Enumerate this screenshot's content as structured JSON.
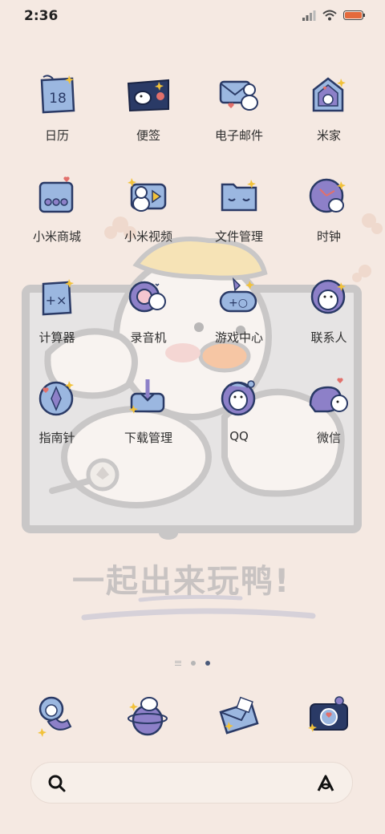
{
  "status_bar": {
    "time": "2:36"
  },
  "wallpaper": {
    "caption": "一起出来玩鸭!"
  },
  "apps": [
    {
      "label": "日历",
      "icon": "calendar-icon",
      "badge": "18"
    },
    {
      "label": "便签",
      "icon": "notes-icon"
    },
    {
      "label": "电子邮件",
      "icon": "email-icon"
    },
    {
      "label": "米家",
      "icon": "mijia-icon"
    },
    {
      "label": "小米商城",
      "icon": "mi-store-icon"
    },
    {
      "label": "小米视频",
      "icon": "mi-video-icon"
    },
    {
      "label": "文件管理",
      "icon": "file-manager-icon"
    },
    {
      "label": "时钟",
      "icon": "clock-icon"
    },
    {
      "label": "计算器",
      "icon": "calculator-icon"
    },
    {
      "label": "录音机",
      "icon": "recorder-icon"
    },
    {
      "label": "游戏中心",
      "icon": "game-center-icon"
    },
    {
      "label": "联系人",
      "icon": "contacts-icon"
    },
    {
      "label": "指南针",
      "icon": "compass-icon"
    },
    {
      "label": "下载管理",
      "icon": "downloads-icon"
    },
    {
      "label": "QQ",
      "icon": "qq-icon"
    },
    {
      "label": "微信",
      "icon": "wechat-icon"
    }
  ],
  "dock": [
    {
      "icon": "phone-icon"
    },
    {
      "icon": "browser-icon"
    },
    {
      "icon": "messages-icon"
    },
    {
      "icon": "camera-icon"
    }
  ],
  "colors": {
    "background": "#f5e9e2",
    "icon_blue": "#9bb7e0",
    "icon_navy": "#2a3a66",
    "icon_purple": "#8d80c8",
    "star_yellow": "#f2c23a"
  }
}
